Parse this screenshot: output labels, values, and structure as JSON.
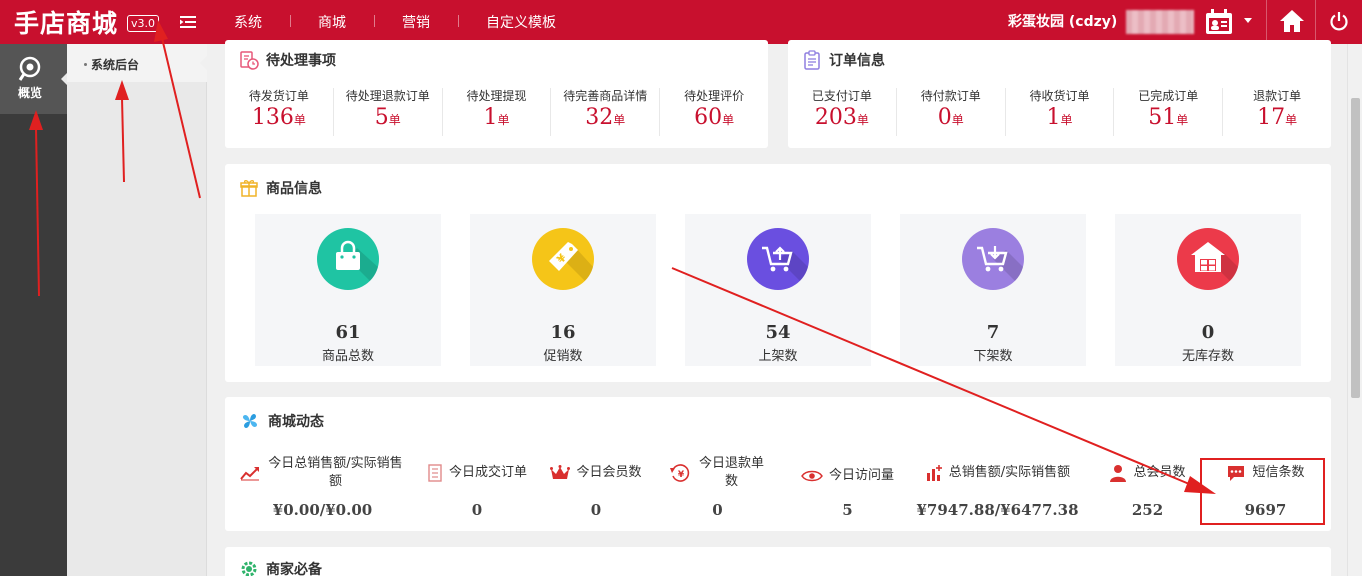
{
  "topbar": {
    "brand": "手店商城",
    "version": "v3.0",
    "nav": [
      "系统",
      "商城",
      "营销",
      "自定义模板"
    ],
    "shop_name": "彩蛋妆园 (cdzy)"
  },
  "sidebar": {
    "primary_label": "概览",
    "secondary_label": "系统后台"
  },
  "pending": {
    "title": "待处理事项",
    "items": [
      {
        "label": "待发货订单",
        "value": "136",
        "unit": "单"
      },
      {
        "label": "待处理退款订单",
        "value": "5",
        "unit": "单"
      },
      {
        "label": "待处理提现",
        "value": "1",
        "unit": "单"
      },
      {
        "label": "待完善商品详情",
        "value": "32",
        "unit": "单"
      },
      {
        "label": "待处理评价",
        "value": "60",
        "unit": "单"
      }
    ]
  },
  "orders": {
    "title": "订单信息",
    "items": [
      {
        "label": "已支付订单",
        "value": "203",
        "unit": "单"
      },
      {
        "label": "待付款订单",
        "value": "0",
        "unit": "单"
      },
      {
        "label": "待收货订单",
        "value": "1",
        "unit": "单"
      },
      {
        "label": "已完成订单",
        "value": "51",
        "unit": "单"
      },
      {
        "label": "退款订单",
        "value": "17",
        "unit": "单"
      }
    ]
  },
  "goods": {
    "title": "商品信息",
    "items": [
      {
        "value": "61",
        "label": "商品总数",
        "color": "#1fc4a3",
        "icon": "shopping-bag-icon"
      },
      {
        "value": "16",
        "label": "促销数",
        "color": "#f5c518",
        "icon": "price-tag-icon"
      },
      {
        "value": "54",
        "label": "上架数",
        "color": "#6a4fe0",
        "icon": "cart-upload-icon"
      },
      {
        "value": "7",
        "label": "下架数",
        "color": "#9b7fe0",
        "icon": "cart-download-icon"
      },
      {
        "value": "0",
        "label": "无库存数",
        "color": "#ec3a4a",
        "icon": "warehouse-icon"
      }
    ]
  },
  "dynamics": {
    "title": "商城动态",
    "items": [
      {
        "label": "今日总销售额/实际销售额",
        "value": "¥0.00/¥0.00",
        "icon": "trend-chart-icon"
      },
      {
        "label": "今日成交订单",
        "value": "0",
        "icon": "receipt-icon"
      },
      {
        "label": "今日会员数",
        "value": "0",
        "icon": "crown-icon"
      },
      {
        "label": "今日退款单数",
        "value": "0",
        "icon": "refund-icon"
      },
      {
        "label": "今日访问量",
        "value": "5",
        "icon": "eye-icon"
      },
      {
        "label": "总销售额/实际销售额",
        "value": "¥7947.88/¥6477.38",
        "icon": "bar-chart-icon"
      },
      {
        "label": "总会员数",
        "value": "252",
        "icon": "user-icon"
      },
      {
        "label": "短信条数",
        "value": "9697",
        "icon": "sms-icon"
      }
    ]
  },
  "merchant": {
    "title": "商家必备"
  },
  "colors": {
    "brand_red": "#c8102e",
    "annotation_red": "#e02020"
  }
}
